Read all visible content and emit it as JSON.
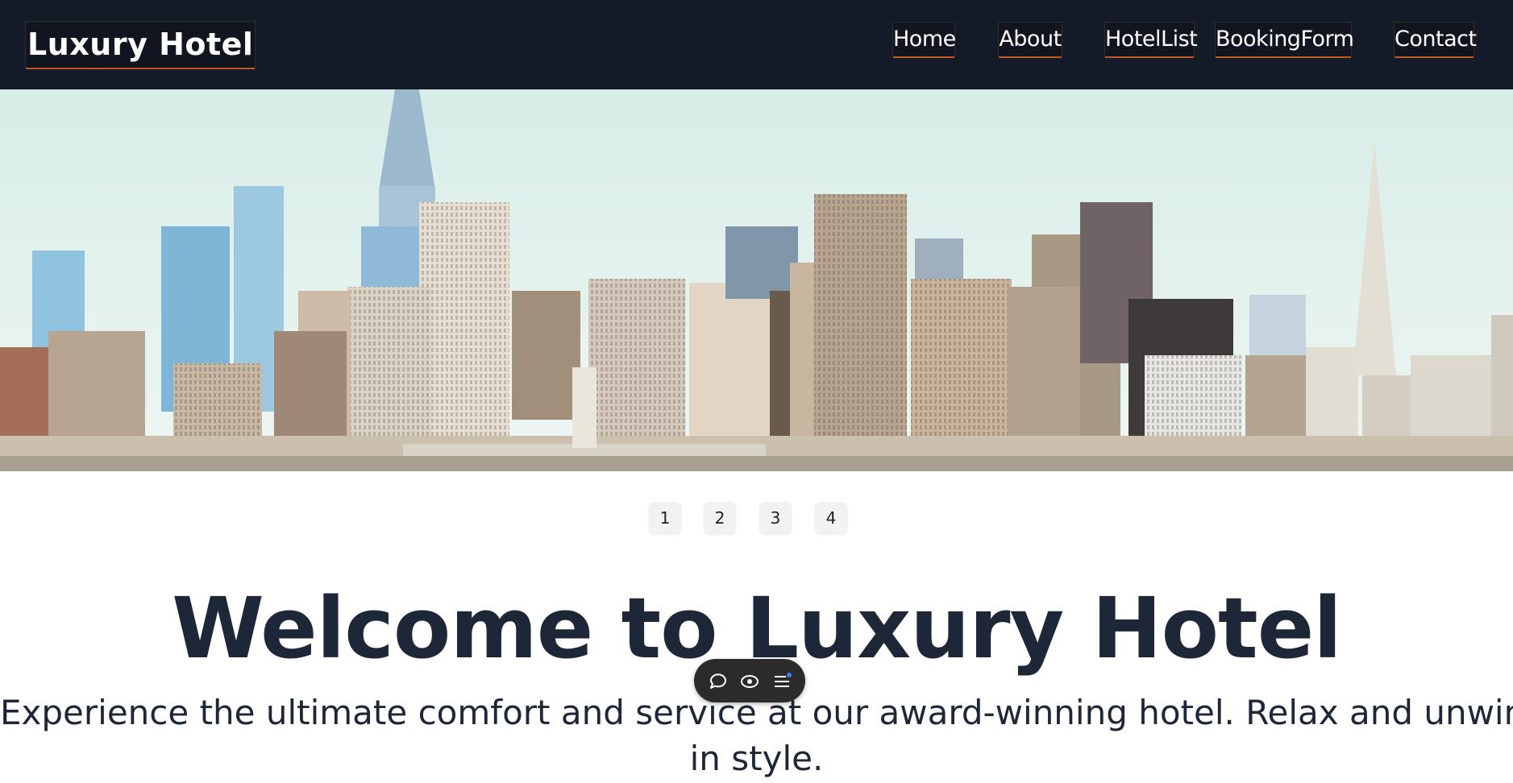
{
  "navbar": {
    "brand": "Luxury Hotel",
    "links": [
      "Home",
      "About",
      "HotelList",
      "BookingForm",
      "Contact"
    ],
    "background": "#131a28",
    "accent": "#c2561e"
  },
  "hero": {
    "image": "city-skyline-photo"
  },
  "pagination": {
    "pages": [
      "1",
      "2",
      "3",
      "4"
    ]
  },
  "main": {
    "title": "Welcome to Luxury Hotel",
    "subtitle": "Experience the ultimate comfort and service at our award-winning hotel. Relax and unwind",
    "subtitle_overflow": "in style."
  },
  "floating_toolbar": {
    "buttons": [
      "comment-icon",
      "eye-icon",
      "menu-icon"
    ]
  }
}
